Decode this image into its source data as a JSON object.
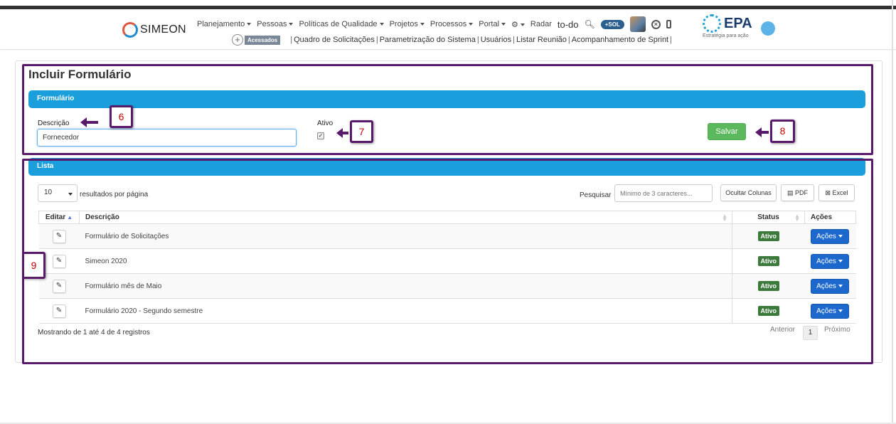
{
  "header": {
    "logo_text": "SIMEON",
    "menu": [
      {
        "label": "Planejamento",
        "dropdown": true
      },
      {
        "label": "Pessoas",
        "dropdown": true
      },
      {
        "label": "Políticas de Qualidade",
        "dropdown": true
      },
      {
        "label": "Projetos",
        "dropdown": true
      },
      {
        "label": "Processos",
        "dropdown": true
      },
      {
        "label": "Portal",
        "dropdown": true
      }
    ],
    "radar_label": "Radar",
    "todo_label": "to-do",
    "sol_badge": "+SOL",
    "acessados_label": "Acessados",
    "quick_links": [
      "Quadro de Solicitações",
      "Parametrização do Sistema",
      "Usuários",
      "Listar Reunião",
      "Acompanhamento de Sprint"
    ],
    "epa_text": "EPA",
    "epa_subtitle": "Estratégia para ação"
  },
  "page": {
    "title": "Incluir Formulário"
  },
  "form": {
    "section_title": "Formulário",
    "descricao_label": "Descrição",
    "descricao_value": "Fornecedor",
    "ativo_label": "Ativo",
    "ativo_checked": true,
    "save_label": "Salvar"
  },
  "list": {
    "section_title": "Lista",
    "page_length": "10",
    "per_page_label": "resultados por página",
    "search_label": "Pesquisar",
    "search_placeholder": "Mínimo de 3 caracteres...",
    "buttons": {
      "columns": "Ocultar Colunas",
      "pdf": "PDF",
      "excel": "Excel"
    },
    "columns": [
      "Editar",
      "Descrição",
      "Status",
      "Ações"
    ],
    "rows": [
      {
        "descricao": "Formulário de Solicitações",
        "status": "Ativo",
        "acoes": "Ações"
      },
      {
        "descricao": "Simeon 2020",
        "status": "Ativo",
        "acoes": "Ações"
      },
      {
        "descricao": "Formulário mês de Maio",
        "status": "Ativo",
        "acoes": "Ações"
      },
      {
        "descricao": "Formulário 2020 - Segundo semestre",
        "status": "Ativo",
        "acoes": "Ações"
      }
    ],
    "info": "Mostrando de 1 até 4 de 4 registros",
    "pagination": {
      "previous": "Anterior",
      "current": "1",
      "next": "Próximo"
    }
  },
  "annotations": [
    "6",
    "7",
    "8",
    "9"
  ],
  "colors": {
    "section_blue": "#1a9fdc",
    "save_green": "#5cb85c",
    "acoes_blue": "#1c68cc",
    "status_green": "#3c7a3c",
    "annotation_purple": "#5a1a6b",
    "annotation_red": "#cc0000"
  }
}
